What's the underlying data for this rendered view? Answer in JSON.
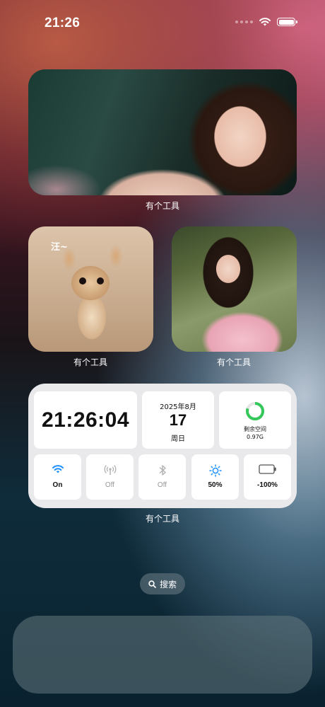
{
  "status_bar": {
    "time": "21:26"
  },
  "widgets": {
    "top_photo": {
      "label": "有个工具"
    },
    "dog_photo": {
      "label": "有个工具",
      "overlay_text": "汪~"
    },
    "girl_photo": {
      "label": "有个工具"
    },
    "info_widget": {
      "label": "有个工具",
      "clock": "21:26:04",
      "date": {
        "year_month": "2025年8月",
        "day": "17",
        "weekday": "周日"
      },
      "storage": {
        "label": "剩余空间",
        "value": "0.97G",
        "ring_fraction": 0.8,
        "ring_color": "#34c759"
      },
      "toggles": [
        {
          "name": "wifi",
          "label": "On",
          "state": "on",
          "icon": "wifi-icon",
          "color": "#1e90ff"
        },
        {
          "name": "cellular",
          "label": "Off",
          "state": "off",
          "icon": "antenna-icon",
          "color": "#b0b0b0"
        },
        {
          "name": "bluetooth",
          "label": "Off",
          "state": "off",
          "icon": "bluetooth-icon",
          "color": "#b0b0b0"
        },
        {
          "name": "brightness",
          "label": "50%",
          "state": "on",
          "icon": "sun-icon",
          "color": "#1e90ff"
        },
        {
          "name": "battery",
          "label": "-100%",
          "state": "on",
          "icon": "battery-icon",
          "color": "#555555"
        }
      ]
    }
  },
  "search": {
    "label": "搜索",
    "icon": "search-icon"
  }
}
